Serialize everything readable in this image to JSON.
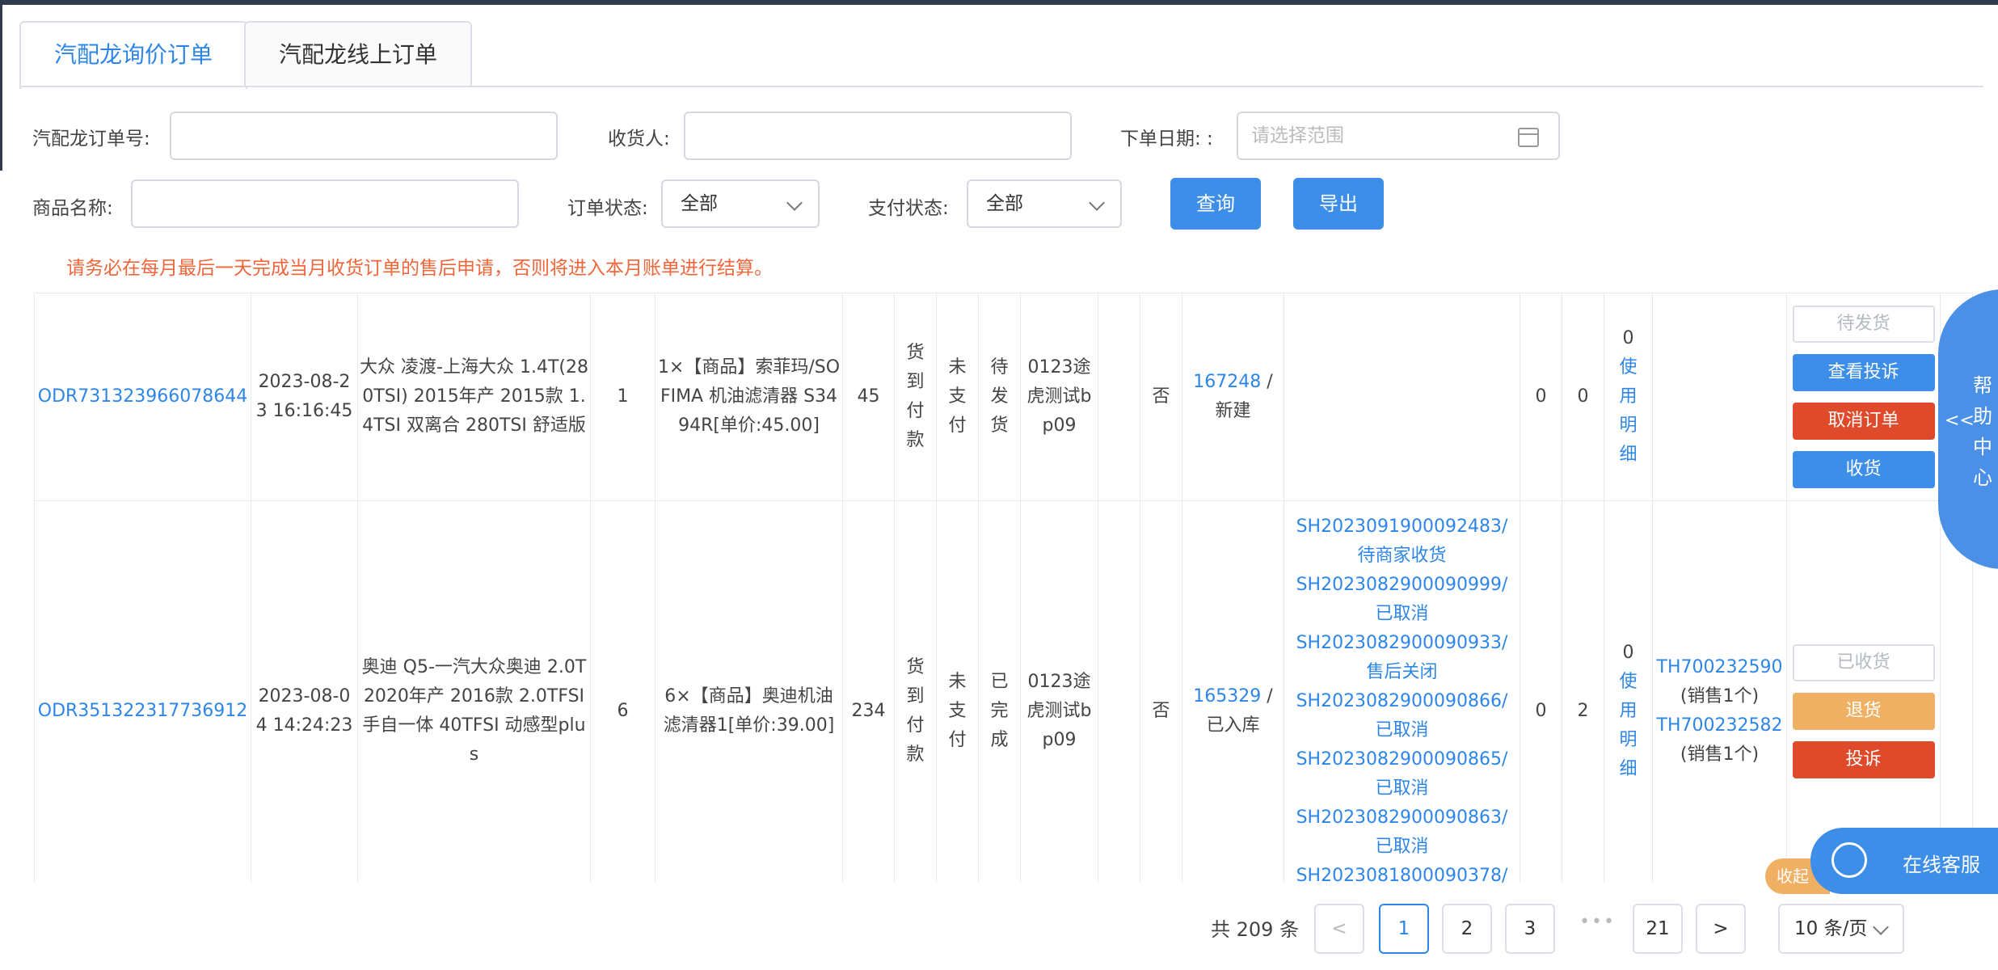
{
  "tabs": [
    {
      "label": "汽配龙询价订单"
    },
    {
      "label": "汽配龙线上订单"
    }
  ],
  "filters": {
    "order_no_label": "汽配龙订单号:",
    "consignee_label": "收货人:",
    "order_date_label": "下单日期: :",
    "order_date_placeholder": "请选择范围",
    "product_name_label": "商品名称:",
    "order_status_label": "订单状态:",
    "order_status_value": "全部",
    "pay_status_label": "支付状态:",
    "pay_status_value": "全部",
    "query_label": "查询",
    "export_label": "导出"
  },
  "notice": "请务必在每月最后一天完成当月收货订单的售后申请，否则将进入本月账单进行结算。",
  "orders": [
    {
      "order_no": "ODR731323966078644",
      "date": "2023-08-23 16:16:45",
      "vehicle": "大众 凌渡-上海大众 1.4T(280TSI) 2015年产 2015款 1.4TSI 双离合 280TSI 舒适版",
      "qty": "1",
      "product": "1×【商品】索菲玛/SOFIMA 机油滤清器 S3494R[单价:45.00]",
      "amount": "45",
      "pay_method": "货到付款",
      "pay_status": "未支付",
      "order_status": "待发货",
      "store": "0123途虎测试bp09",
      "blank": "",
      "flag": "否",
      "ref_no": "167248",
      "ref_sep": " / ",
      "ref_status": "新建",
      "aftersales": [],
      "n1": "0",
      "n2": "0",
      "usage_count": "0",
      "usage_link": "使用明细",
      "returns": [],
      "actions": [
        {
          "label": "待发货",
          "style": "disabled"
        },
        {
          "label": "查看投诉",
          "style": "blue"
        },
        {
          "label": "取消订单",
          "style": "red"
        },
        {
          "label": "收货",
          "style": "blue"
        }
      ]
    },
    {
      "order_no": "ODR351322317736912",
      "date": "2023-08-04 14:24:23",
      "vehicle": "奥迪 Q5-一汽大众奥迪 2.0T 2020年产 2016款 2.0TFSI 手自一体 40TFSI 动感型plus",
      "qty": "6",
      "product": "6×【商品】奥迪机油滤清器1[单价:39.00]",
      "amount": "234",
      "pay_method": "货到付款",
      "pay_status": "未支付",
      "order_status": "已完成",
      "store": "0123途虎测试bp09",
      "blank": "",
      "flag": "否",
      "ref_no": "165329",
      "ref_sep": " / ",
      "ref_status": "已入库",
      "aftersales": [
        {
          "no": "SH2023091900092483/",
          "status": "待商家收货"
        },
        {
          "no": "SH2023082900090999/",
          "status": "已取消"
        },
        {
          "no": "SH2023082900090933/",
          "status": "售后关闭"
        },
        {
          "no": "SH2023082900090866/",
          "status": "已取消"
        },
        {
          "no": "SH2023082900090865/",
          "status": "已取消"
        },
        {
          "no": "SH2023082900090863/",
          "status": "已取消"
        },
        {
          "no": "SH2023081800090378/",
          "status": ""
        }
      ],
      "n1": "0",
      "n2": "2",
      "usage_count": "0",
      "usage_link": "使用明细",
      "returns": [
        {
          "no": "TH700232590",
          "desc": "(销售1个)"
        },
        {
          "no": "TH700232582",
          "desc": "(销售1个)"
        }
      ],
      "actions": [
        {
          "label": "已收货",
          "style": "disabled"
        },
        {
          "label": "退货",
          "style": "orange"
        },
        {
          "label": "投诉",
          "style": "red"
        }
      ]
    }
  ],
  "help_center": {
    "label": "帮助中心",
    "arrow": "<<"
  },
  "online_service": {
    "label": "在线客服",
    "collapse_label": "收起"
  },
  "pagination": {
    "total": "共 209 条",
    "prev": "<",
    "pages": [
      "1",
      "2",
      "3"
    ],
    "dots": "•••",
    "last": "21",
    "next": ">",
    "page_size": "10 条/页",
    "current": "1"
  }
}
